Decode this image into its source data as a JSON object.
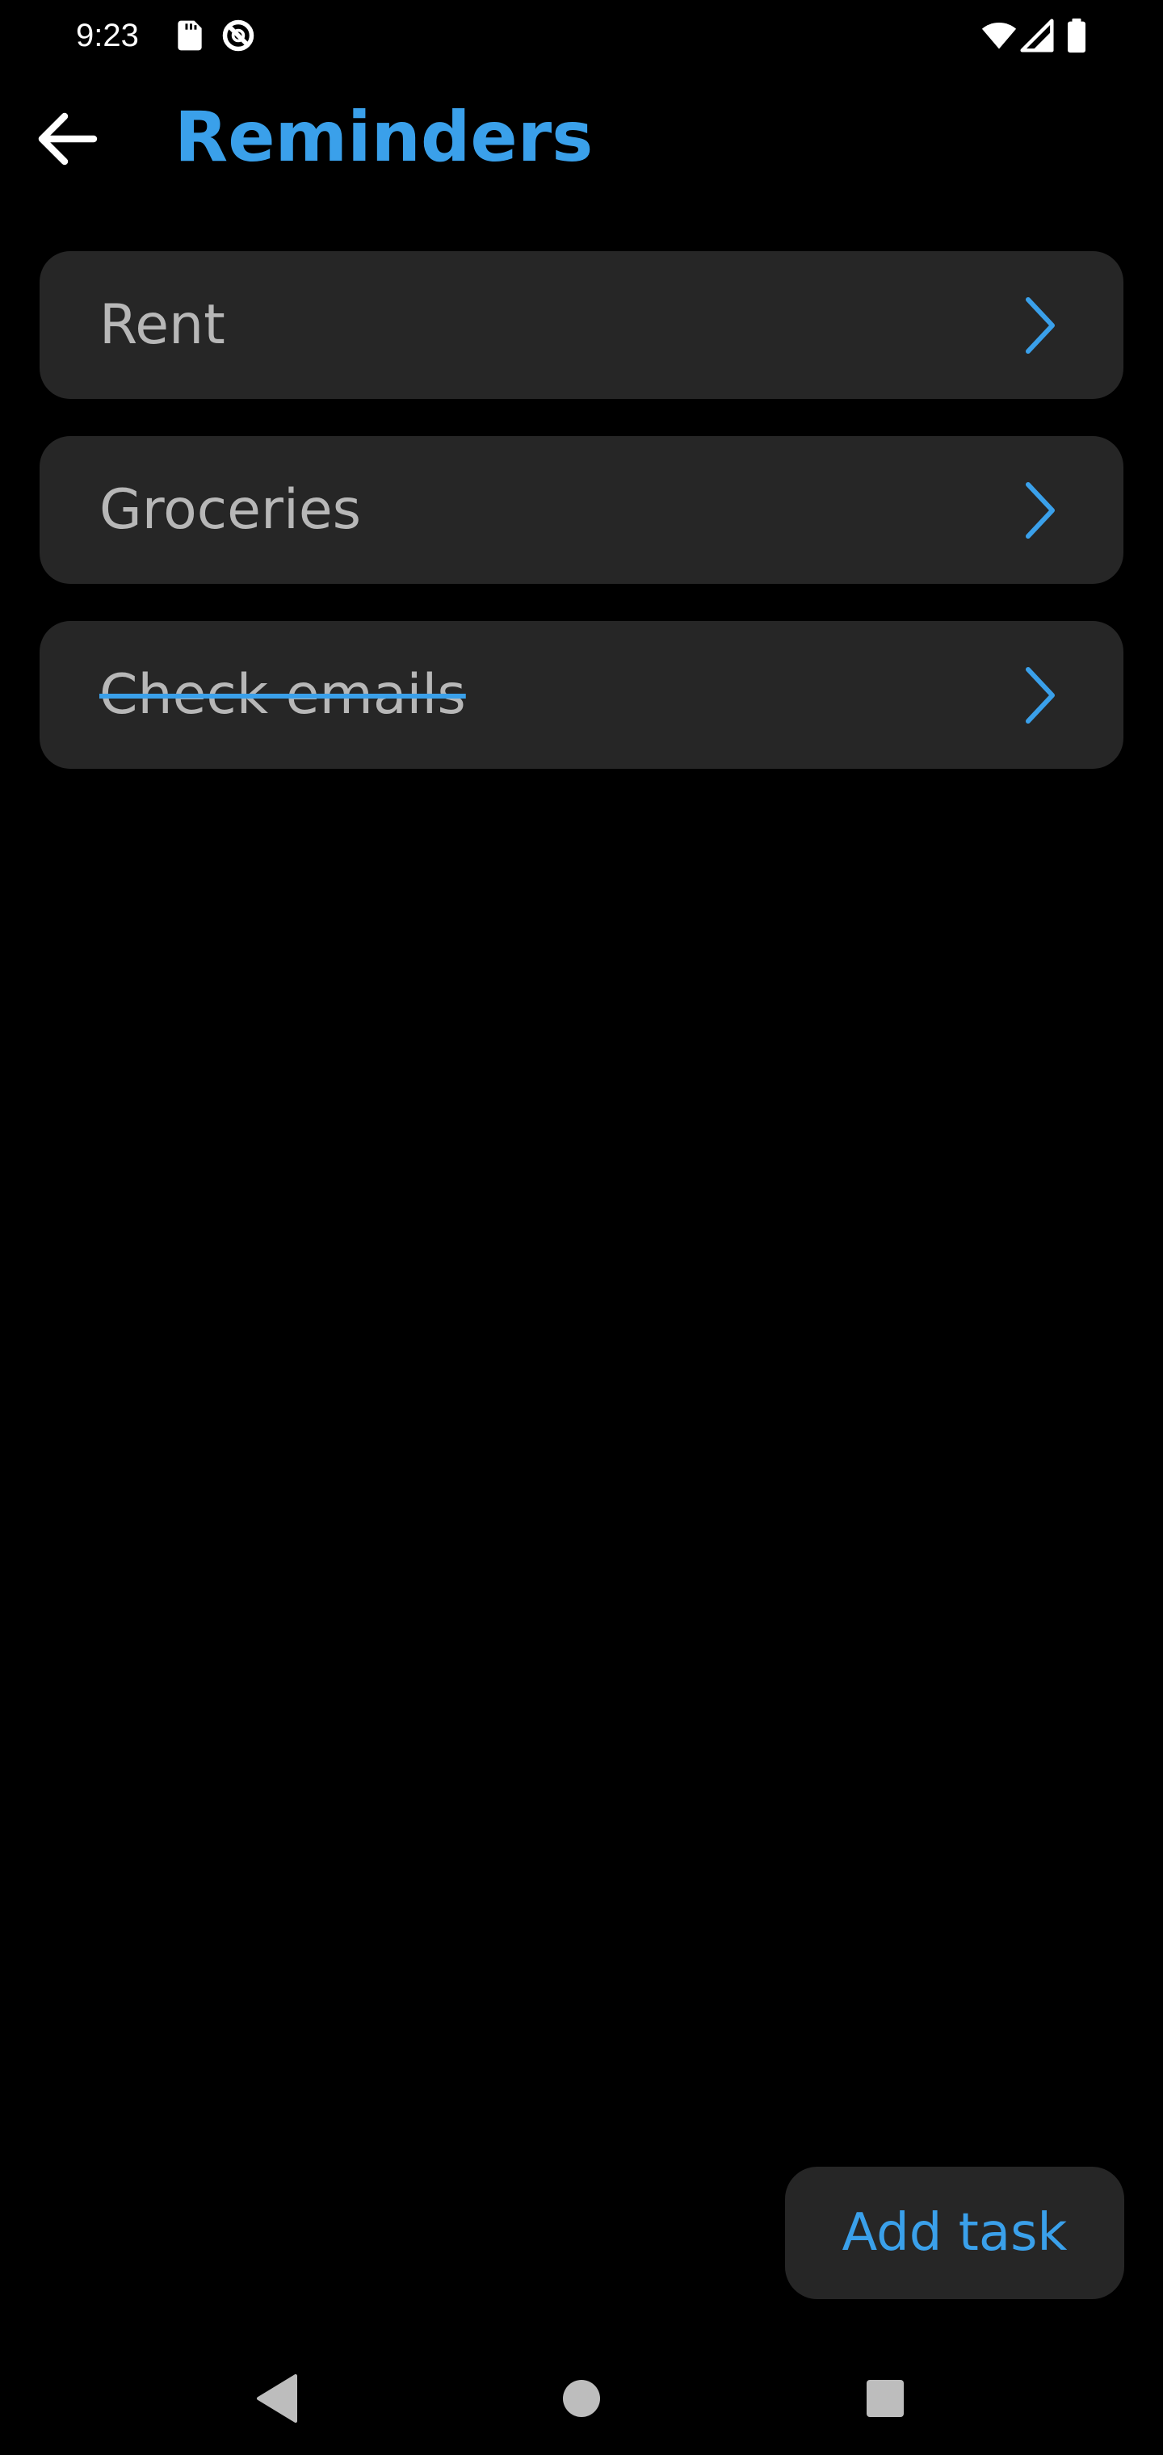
{
  "status_bar": {
    "time": "9:23",
    "left_icons": [
      "sd-card-icon",
      "do-not-disturb-icon"
    ],
    "right_icons": [
      "wifi-icon",
      "cell-signal-icon",
      "battery-icon"
    ]
  },
  "app_bar": {
    "title": "Reminders",
    "back_icon": "arrow-left-icon"
  },
  "tasks": [
    {
      "label": "Rent",
      "completed": false
    },
    {
      "label": "Groceries",
      "completed": false
    },
    {
      "label": "Check emails",
      "completed": true
    }
  ],
  "add_task_label": "Add task",
  "nav_bar": {
    "icons": [
      "nav-back-icon",
      "nav-home-icon",
      "nav-recents-icon"
    ]
  },
  "colors": {
    "accent": "#3aa0ea",
    "card_background": "#262626",
    "background": "#000000",
    "task_text": "#b7b7b7"
  }
}
